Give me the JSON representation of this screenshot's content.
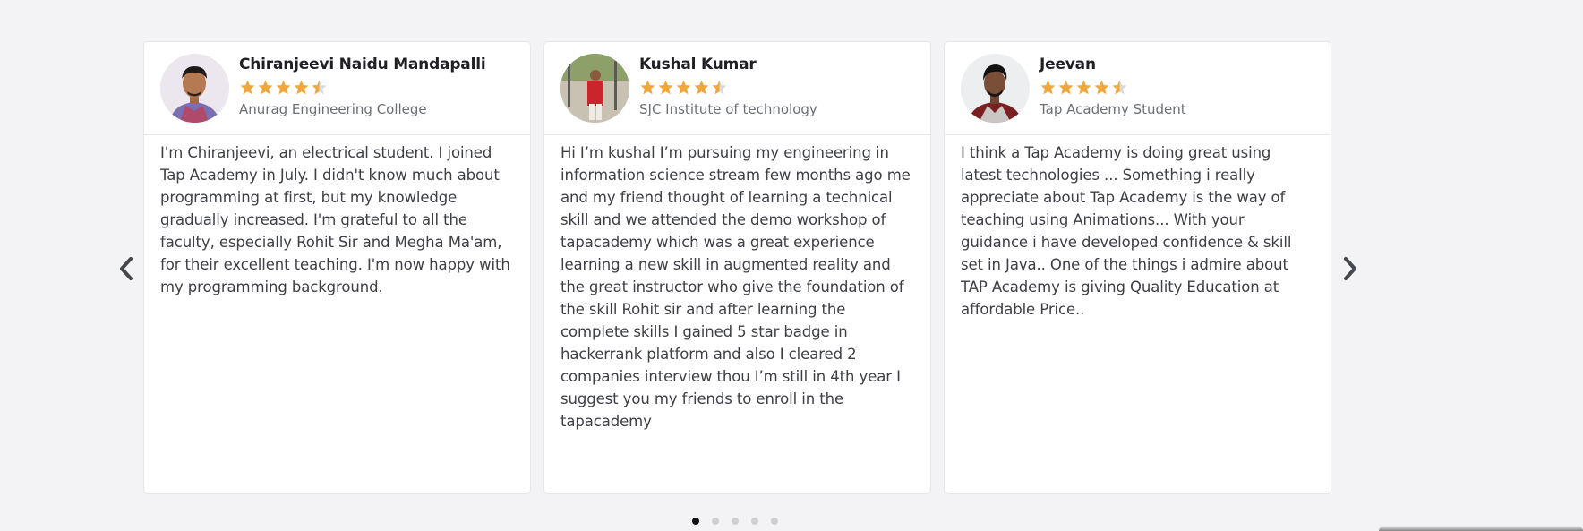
{
  "testimonials": [
    {
      "name": "Chiranjeevi Naidu Mandapalli",
      "rating": 4.5,
      "college": "Anurag Engineering College",
      "review": "I'm Chiranjeevi, an electrical student. I joined Tap Academy in July. I didn't know much about programming at first, but my knowledge gradually increased. I'm grateful to all the faculty, especially Rohit Sir and Megha Ma'am, for their excellent teaching. I'm now happy with my programming background."
    },
    {
      "name": "Kushal Kumar",
      "rating": 4.5,
      "college": "SJC Institute of technology",
      "review": "Hi I’m kushal I’m pursuing my engineering in information science stream few months ago me and my friend thought of learning a technical skill and we attended the demo workshop of tapacademy which was a great experience learning a new skill in augmented reality and the great instructor who give the foundation of the skill Rohit sir and after learning the complete skills I gained 5 star badge in hackerrank platform and also I cleared 2 companies interview thou I’m still in 4th year I suggest you my friends to enroll in the tapacademy"
    },
    {
      "name": "Jeevan",
      "rating": 4.5,
      "college": "Tap Academy Student",
      "review": "I think a Tap Academy is doing great using latest technologies ... Something i really appreciate about Tap Academy is the way of teaching using Animations... With your guidance i have developed confidence & skill set in Java.. One of the things i admire about TAP Academy is giving Quality Education at affordable Price.."
    }
  ],
  "carousel": {
    "page_count": 5,
    "active_page": 1,
    "prev_icon": "chevron-left-icon",
    "next_icon": "chevron-right-icon"
  },
  "colors": {
    "star_filled": "#f0a83a",
    "star_empty": "#d9d9dc",
    "background": "#f3f3f5"
  }
}
